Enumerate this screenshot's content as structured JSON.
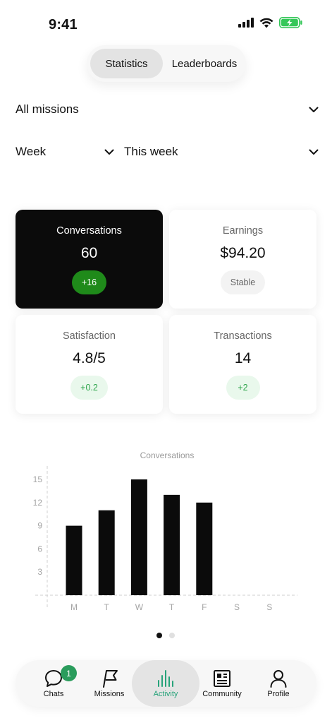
{
  "status": {
    "time": "9:41"
  },
  "segments": {
    "active": "Statistics",
    "other": "Leaderboards"
  },
  "filters": {
    "mission": "All missions",
    "period": "Week",
    "range": "This week"
  },
  "cards": [
    {
      "label": "Conversations",
      "value": "60",
      "badge": "+16"
    },
    {
      "label": "Earnings",
      "value": "$94.20",
      "badge": "Stable"
    },
    {
      "label": "Satisfaction",
      "value": "4.8/5",
      "badge": "+0.2"
    },
    {
      "label": "Transactions",
      "value": "14",
      "badge": "+2"
    }
  ],
  "chart_data": {
    "type": "bar",
    "title": "Conversations",
    "categories": [
      "M",
      "T",
      "W",
      "T",
      "F",
      "S",
      "S"
    ],
    "values": [
      9,
      11,
      15,
      13,
      12,
      0,
      0
    ],
    "yticks": [
      3,
      6,
      9,
      12,
      15
    ],
    "ylim": [
      0,
      15
    ],
    "grid": false,
    "bar_color": "#0b0b0b"
  },
  "pager": {
    "pages": 2,
    "active": 0
  },
  "tabs": [
    {
      "label": "Chats",
      "badge": "1",
      "icon": "chat-bubble-icon"
    },
    {
      "label": "Missions",
      "icon": "flag-icon"
    },
    {
      "label": "Activity",
      "icon": "bar-chart-icon"
    },
    {
      "label": "Community",
      "icon": "newspaper-icon"
    },
    {
      "label": "Profile",
      "icon": "person-icon"
    }
  ],
  "colors": {
    "accent_green": "#1f8a1a",
    "active_tab": "#27a37a",
    "badge_green": "#2a9c5c",
    "battery": "#35c759"
  }
}
